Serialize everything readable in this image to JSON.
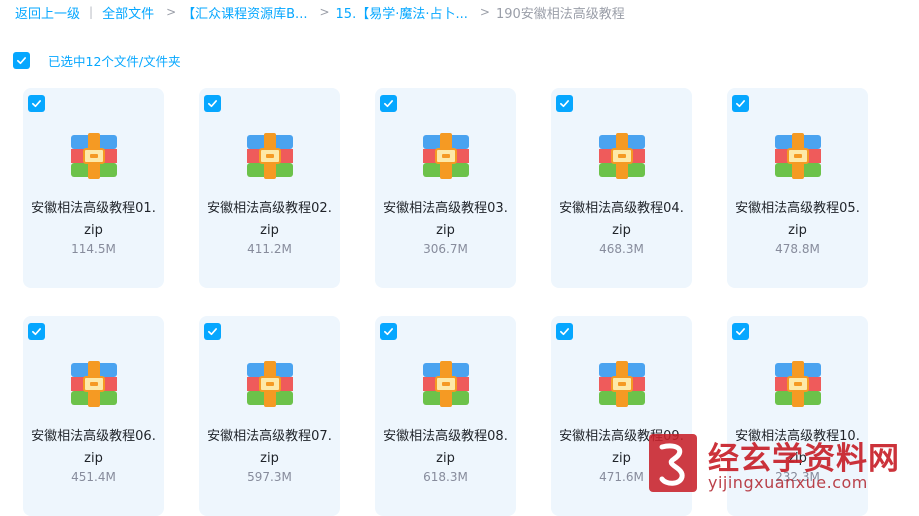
{
  "breadcrumb": {
    "back": "返回上一级",
    "all_files": "全部文件",
    "path1": "【汇众课程资源库B...",
    "path2": "15.【易学·魔法·占卜...",
    "current": "190安徽相法高级教程"
  },
  "selection": {
    "label": "已选中12个文件/文件夹"
  },
  "files": [
    {
      "name": "安徽相法高级教程01.zip",
      "size": "114.5M"
    },
    {
      "name": "安徽相法高级教程02.zip",
      "size": "411.2M"
    },
    {
      "name": "安徽相法高级教程03.zip",
      "size": "306.7M"
    },
    {
      "name": "安徽相法高级教程04.zip",
      "size": "468.3M"
    },
    {
      "name": "安徽相法高级教程05.zip",
      "size": "478.8M"
    },
    {
      "name": "安徽相法高级教程06.zip",
      "size": "451.4M"
    },
    {
      "name": "安徽相法高级教程07.zip",
      "size": "597.3M"
    },
    {
      "name": "安徽相法高级教程08.zip",
      "size": "618.3M"
    },
    {
      "name": "安徽相法高级教程09.zip",
      "size": "471.6M"
    },
    {
      "name": "安徽相法高级教程10.zip",
      "size": "232.3M"
    }
  ],
  "icons": {
    "checkbox": "check-icon",
    "file": "zip-archive-icon"
  },
  "colors": {
    "accent": "#06a7ff",
    "card_bg": "#eef6fd"
  },
  "watermark": {
    "title": "经玄学资料网",
    "url": "yijingxuanxue.com"
  }
}
